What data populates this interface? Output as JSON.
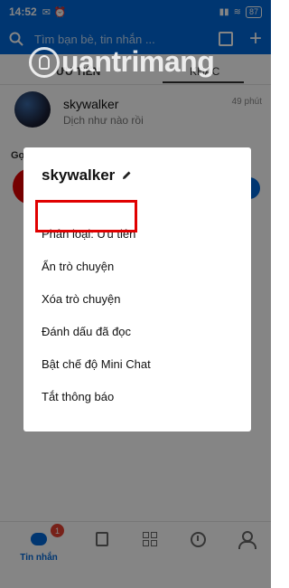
{
  "status_bar": {
    "time": "14:52",
    "battery": "87"
  },
  "search": {
    "placeholder": "Tìm bạn bè, tin nhắn ..."
  },
  "tabs": [
    {
      "label": "ƯU TIÊN"
    },
    {
      "label": "KHÁC"
    }
  ],
  "conversation": {
    "name": "skywalker",
    "preview": "Dịch như nào rồi",
    "time": "49 phút"
  },
  "suggestions": {
    "title": "Gợi ý"
  },
  "watermark": {
    "text": "uantrimang"
  },
  "menu": {
    "title": "skywalker",
    "items": [
      "Phân loại: Ưu tiên",
      "Ẩn trò chuyện",
      "Xóa trò chuyện",
      "Đánh dấu đã đọc",
      "Bật chế độ Mini Chat",
      "Tắt thông báo"
    ]
  },
  "bottom_nav": {
    "messages_label": "Tin nhắn",
    "badge": "1",
    "icons": [
      "chat-bubble-icon",
      "contacts-icon",
      "apps-grid-icon",
      "clock-icon",
      "person-icon"
    ]
  },
  "colors": {
    "brand": "#0068d8",
    "highlight": "#e00000",
    "badge": "#e54030"
  }
}
